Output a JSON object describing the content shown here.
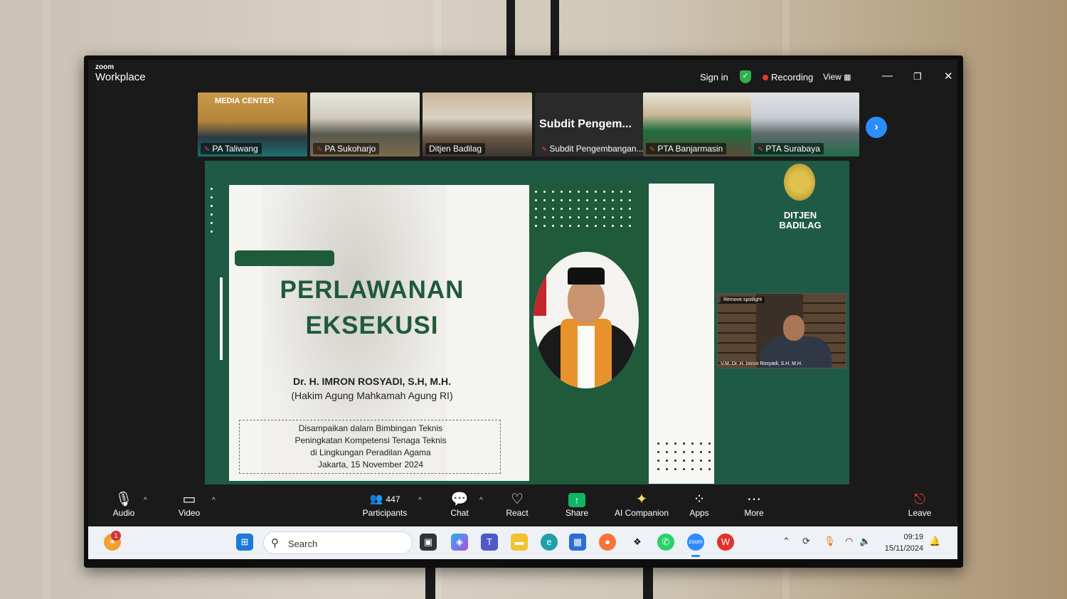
{
  "app": {
    "logo_small": "zoom",
    "logo_big": "Workplace",
    "sign_in": "Sign in",
    "recording": "Recording",
    "view": "View"
  },
  "thumbnails": [
    {
      "label": "PA Taliwang",
      "banner": "MEDIA CENTER"
    },
    {
      "label": "PA Sukoharjo"
    },
    {
      "label": "Ditjen Badilag"
    },
    {
      "label": "Subdit Pengembangan...",
      "big_title": "Subdit  Pengem..."
    },
    {
      "label": "PTA Banjarmasin"
    },
    {
      "label": "PTA Surabaya"
    }
  ],
  "slide": {
    "title_line1": "PERLAWANAN",
    "title_line2": "EKSEKUSI",
    "speaker_name": "Dr. H. IMRON ROSYADI, S.H, M.H.",
    "speaker_role": "(Hakim Agung Mahkamah Agung RI)",
    "box_lines": [
      "Disampaikan dalam Bimbingan Teknis",
      "Peningkatan Kompetensi Tenaga Teknis",
      "di Lingkungan Peradilan Agama",
      "Jakarta, 15 November 2024"
    ],
    "logo_text_1": "DITJEN",
    "logo_text_2": "BADILAG"
  },
  "spotlight": {
    "tag": "Remove spotlight",
    "name": "V.M. Dr. H. Imron Rosyadi, S.H, M.H."
  },
  "toolbar": {
    "audio": "Audio",
    "video": "Video",
    "participants": "Participants",
    "participants_count": "447",
    "chat": "Chat",
    "react": "React",
    "share": "Share",
    "ai_companion": "AI Companion",
    "apps": "Apps",
    "more": "More",
    "leave": "Leave"
  },
  "taskbar": {
    "search_placeholder": "Search",
    "time": "09:19",
    "date": "15/11/2024",
    "badge": "1"
  },
  "colors": {
    "slide_green": "#1f5a3a",
    "zoom_blue": "#2d8cff",
    "share_green": "#12b562",
    "record_red": "#e5383b"
  }
}
